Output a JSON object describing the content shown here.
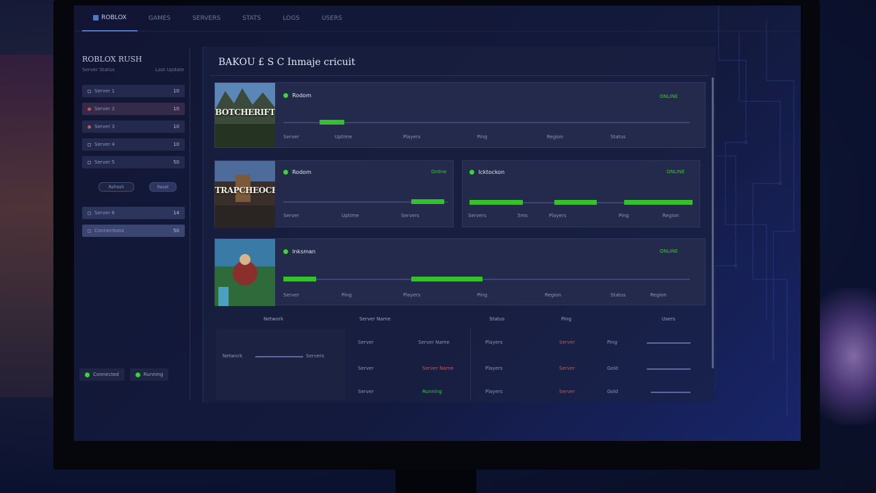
{
  "nav": {
    "tabs": [
      {
        "label": "ROBLOX"
      },
      {
        "label": "GAMES"
      },
      {
        "label": "SERVERS"
      },
      {
        "label": "STATS"
      },
      {
        "label": "LOGS"
      },
      {
        "label": "USERS"
      }
    ]
  },
  "sidebar": {
    "title": "ROBLOX RUSH",
    "sub_left": "Server Status",
    "sub_right": "Last Update",
    "items": [
      {
        "label": "Server 1",
        "value": "10"
      },
      {
        "label": "Server 2",
        "value": "10"
      },
      {
        "label": "Server 3",
        "value": "10"
      },
      {
        "label": "Server 4",
        "value": "10"
      },
      {
        "label": "Server 5",
        "value": "50"
      }
    ],
    "buttons": [
      "Refresh",
      "Reset"
    ],
    "lower_items": [
      {
        "label": "Server 6",
        "value": "14"
      },
      {
        "label": "Connections",
        "value": "50"
      }
    ],
    "status_chips": [
      "Connected",
      "Running"
    ]
  },
  "main": {
    "title": "BAKOU £ S C Inmaje cricuit",
    "cards": [
      {
        "thumb_label": "BOTCHERIFT",
        "name": "Rodom",
        "status": "ONLINE",
        "stats": [
          "Server",
          "Uptime",
          "Players",
          "Ping",
          "Region",
          "Status"
        ],
        "progress": [
          0.09,
          0.15
        ]
      },
      {
        "thumb_label": "TRAPCHEOCH",
        "name": "Rodom",
        "status": "Online",
        "stats": [
          "Server",
          "Uptime",
          "Servers"
        ],
        "progress": [
          0.78,
          0.98
        ]
      },
      {
        "thumb_label": "",
        "name": "Icktockon",
        "status": "ONLINE",
        "stats": [
          "Servers",
          "5ms",
          "Players",
          "Ping",
          "Region"
        ],
        "progress": [
          0.0,
          0.9
        ]
      },
      {
        "thumb_label": "",
        "name": "Inksman",
        "status": "ONLINE",
        "stats": [
          "Server",
          "Ping",
          "Players",
          "Ping",
          "Region",
          "Status",
          "Region"
        ],
        "progress": [
          0.0,
          0.08
        ]
      }
    ],
    "table": {
      "headers": [
        "Network",
        "Server Name",
        "Status",
        "Ping",
        "Users"
      ],
      "left_block": {
        "label_a": "Network",
        "label_b": "Servers"
      },
      "rows": [
        {
          "c1": "Server",
          "c2": "Server Name",
          "c3": "Players",
          "c4": "Server",
          "c5": "Ping"
        },
        {
          "c1": "Server",
          "c2": "Server Name",
          "c3": "Players",
          "c4": "Server",
          "c5": "Gold"
        },
        {
          "c1": "Server",
          "c2": "Running",
          "c3": "Players",
          "c4": "Server",
          "c5": "Gold"
        }
      ]
    }
  },
  "colors": {
    "accent_green": "#33c22b",
    "accent_red": "#c9584a",
    "accent_blue": "#4f79c8"
  }
}
